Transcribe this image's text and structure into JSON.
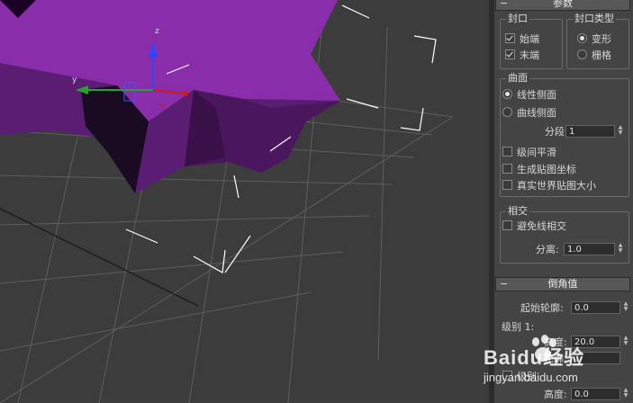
{
  "viewport": {
    "axis_z": "z",
    "axis_y": "y"
  },
  "panel": {
    "params_header": "参数",
    "cap_group": {
      "title": "封口",
      "start": "始端",
      "end": "末端",
      "start_checked": true,
      "end_checked": true
    },
    "cap_type_group": {
      "title": "封口类型",
      "morph": "变形",
      "grid": "栅格",
      "selected": "变形"
    },
    "surface_group": {
      "title": "曲面",
      "linear_sides": "线性侧面",
      "curved_sides": "曲线侧面",
      "selected": "线性侧面",
      "segments_label": "分段:",
      "segments_value": "1",
      "smooth_across_levels": "级间平滑",
      "generate_mapping": "生成贴图坐标",
      "real_world_map_size": "真实世界贴图大小"
    },
    "intersect_group": {
      "title": "相交",
      "avoid_self_intersect": "避免线相交",
      "separation_label": "分离:",
      "separation_value": "1.0"
    },
    "bevel_header": "倒角值",
    "start_outline_label": "起始轮廓:",
    "start_outline_value": "0.0",
    "level1_label": "级别 1:",
    "height_label": "高度:",
    "height1_value": "20.0",
    "outline_label": "轮廓:",
    "level2_label": "级别",
    "height3_value": "0.0"
  },
  "watermark": {
    "brand": "Baidu经验",
    "url": "jingyan.baidu.com"
  }
}
